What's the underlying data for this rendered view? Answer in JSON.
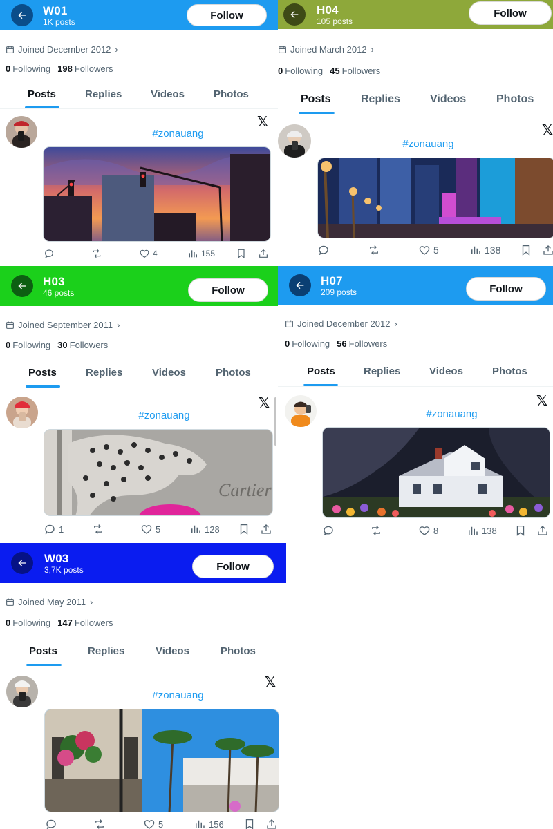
{
  "panels": [
    {
      "name": "W01",
      "posts": "1K posts",
      "header_color": "#1d9bf0",
      "back_color": "#0a4d8a",
      "follow_label": "Follow",
      "joined": "Joined December 2012",
      "following_count": "0",
      "following_label": "Following",
      "followers_count": "198",
      "followers_label": "Followers",
      "tabs": [
        "Posts",
        "Replies",
        "Videos",
        "Photos"
      ],
      "hashtag": "#zonauang",
      "replies": "",
      "reposts": "",
      "likes": "4",
      "views": "155",
      "image": "sunset-city"
    },
    {
      "name": "H04",
      "posts": "105 posts",
      "header_color": "#8ea83a",
      "back_color": "#3e4a16",
      "follow_label": "Follow",
      "joined": "Joined March 2012",
      "following_count": "0",
      "following_label": "Following",
      "followers_count": "45",
      "followers_label": "Followers",
      "tabs": [
        "Posts",
        "Replies",
        "Videos",
        "Photos"
      ],
      "hashtag": "#zonauang",
      "replies": "",
      "reposts": "",
      "likes": "5",
      "views": "138",
      "image": "night-street"
    },
    {
      "name": "H03",
      "posts": "46 posts",
      "header_color": "#1bd01b",
      "back_color": "#0d5f12",
      "follow_label": "Follow",
      "joined": "Joined September 2011",
      "following_count": "0",
      "following_label": "Following",
      "followers_count": "30",
      "followers_label": "Followers",
      "tabs": [
        "Posts",
        "Replies",
        "Videos",
        "Photos"
      ],
      "hashtag": "#zonauang",
      "replies": "1",
      "reposts": "",
      "likes": "5",
      "views": "128",
      "image": "leopard-wall"
    },
    {
      "name": "H07",
      "posts": "209 posts",
      "header_color": "#1d9bf0",
      "back_color": "#0a3f73",
      "follow_label": "Follow",
      "joined": "Joined December 2012",
      "following_count": "0",
      "following_label": "Following",
      "followers_count": "56",
      "followers_label": "Followers",
      "tabs": [
        "Posts",
        "Replies",
        "Videos",
        "Photos"
      ],
      "hashtag": "#zonauang",
      "replies": "",
      "reposts": "",
      "likes": "8",
      "views": "138",
      "image": "white-house"
    },
    {
      "name": "W03",
      "posts": "3,7K posts",
      "header_color": "#0a1cf0",
      "back_color": "#061286",
      "follow_label": "Follow",
      "joined": "Joined May 2011",
      "following_count": "0",
      "following_label": "Following",
      "followers_count": "147",
      "followers_label": "Followers",
      "tabs": [
        "Posts",
        "Replies",
        "Videos",
        "Photos"
      ],
      "hashtag": "#zonauang",
      "replies": "",
      "reposts": "",
      "likes": "5",
      "views": "156",
      "image": "palm-street"
    }
  ],
  "icons": [
    "back-arrow-icon",
    "calendar-icon",
    "x-logo-icon",
    "reply-icon",
    "repost-icon",
    "like-icon",
    "views-icon",
    "bookmark-icon",
    "share-icon"
  ]
}
